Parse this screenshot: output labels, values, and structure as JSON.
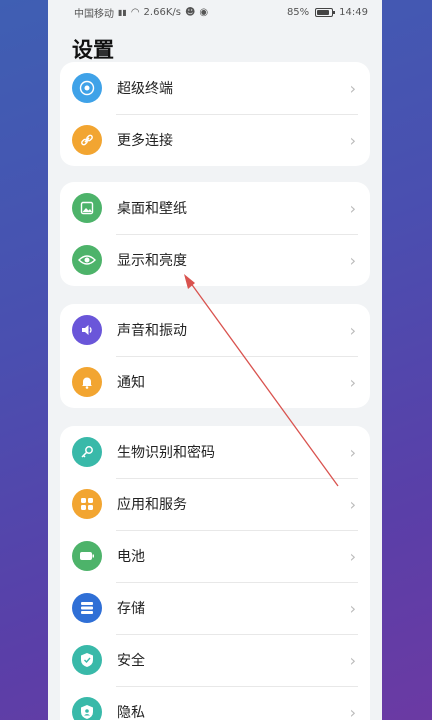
{
  "statusbar": {
    "carrier": "中国移动",
    "signal": "⁴ᴳ",
    "speed": "2.66K/s",
    "battery": "85%",
    "time": "14:49"
  },
  "page": {
    "title": "设置"
  },
  "cards": [
    {
      "items": [
        {
          "label": "超级终端",
          "icon": "super-device-icon",
          "color": "#3fa2e8"
        },
        {
          "label": "更多连接",
          "icon": "link-icon",
          "color": "#f2a531"
        }
      ]
    },
    {
      "items": [
        {
          "label": "桌面和壁纸",
          "icon": "wallpaper-icon",
          "color": "#4db36a"
        },
        {
          "label": "显示和亮度",
          "icon": "eye-icon",
          "color": "#4db36a"
        }
      ]
    },
    {
      "items": [
        {
          "label": "声音和振动",
          "icon": "volume-icon",
          "color": "#6a56d9"
        },
        {
          "label": "通知",
          "icon": "bell-icon",
          "color": "#f2a531"
        }
      ]
    },
    {
      "items": [
        {
          "label": "生物识别和密码",
          "icon": "key-icon",
          "color": "#39b9a9"
        },
        {
          "label": "应用和服务",
          "icon": "apps-icon",
          "color": "#f2a531"
        },
        {
          "label": "电池",
          "icon": "battery-icon",
          "color": "#4db36a"
        },
        {
          "label": "存储",
          "icon": "storage-icon",
          "color": "#2f6fd6"
        },
        {
          "label": "安全",
          "icon": "shield-icon",
          "color": "#39b9a9"
        },
        {
          "label": "隐私",
          "icon": "privacy-icon",
          "color": "#39b9a9"
        }
      ]
    }
  ]
}
